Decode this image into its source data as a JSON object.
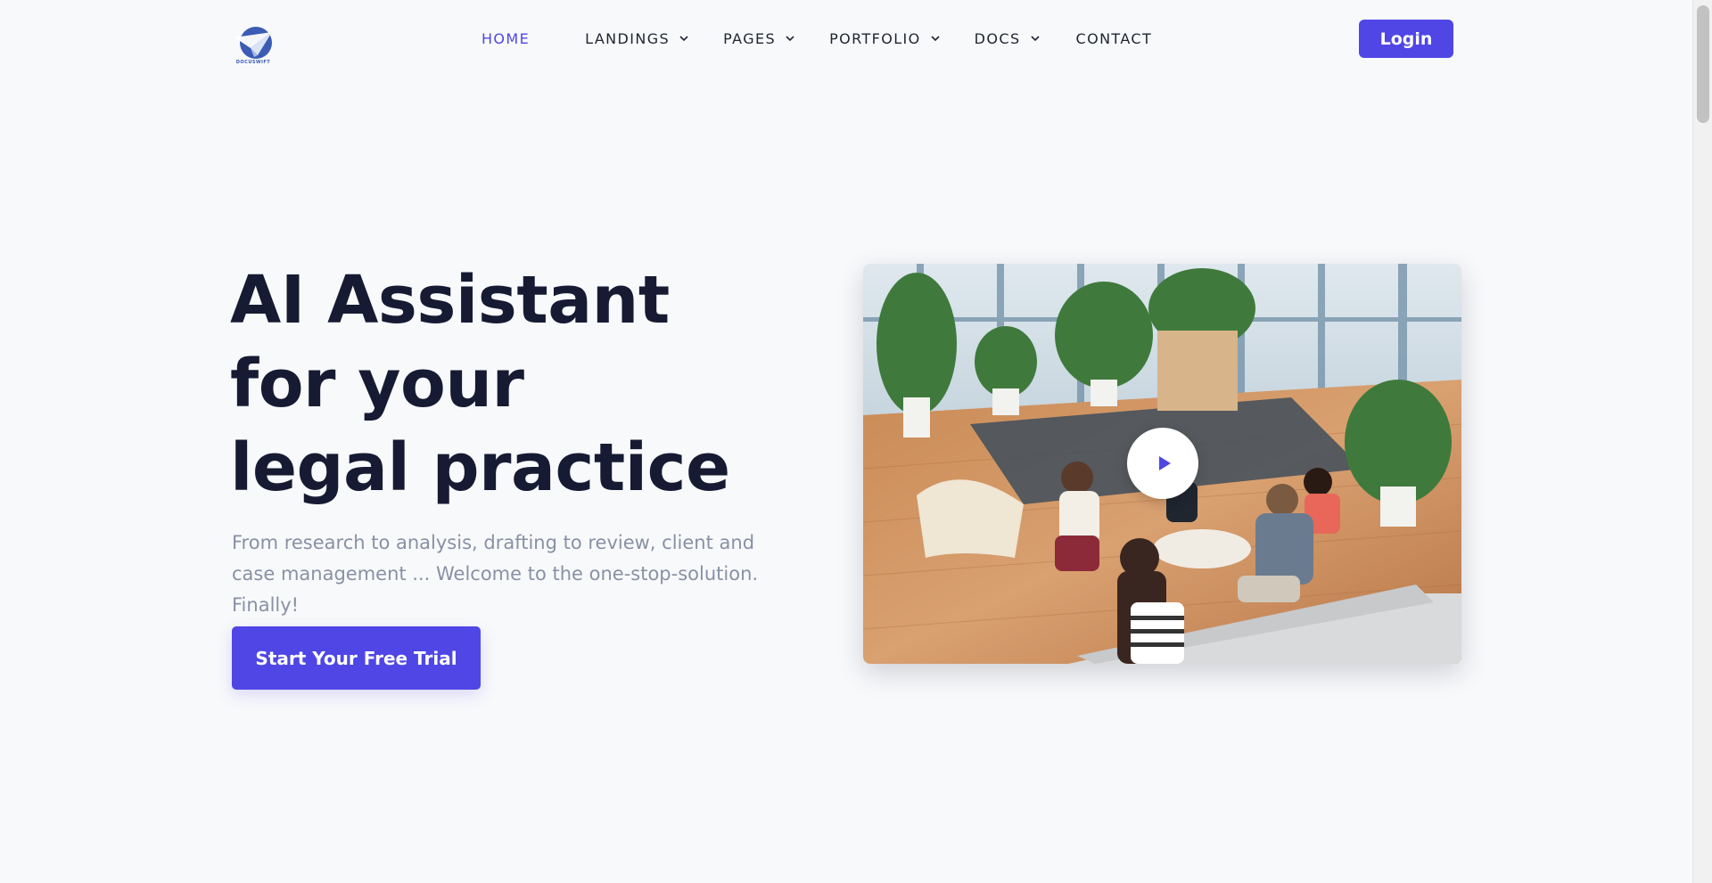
{
  "header": {
    "logo_text": "DOCUSWIFT",
    "nav": [
      {
        "label": "HOME",
        "has_dropdown": false,
        "active": true
      },
      {
        "label": "LANDINGS",
        "has_dropdown": true,
        "active": false
      },
      {
        "label": "PAGES",
        "has_dropdown": true,
        "active": false
      },
      {
        "label": "PORTFOLIO",
        "has_dropdown": true,
        "active": false
      },
      {
        "label": "DOCS",
        "has_dropdown": true,
        "active": false
      },
      {
        "label": "CONTACT",
        "has_dropdown": false,
        "active": false
      }
    ],
    "login_label": "Login"
  },
  "hero": {
    "title_lines": [
      "AI Assistant",
      "for your",
      "legal practice"
    ],
    "subtitle": "From research to analysis, drafting to review, client and case management ... Welcome to the one-stop-solution. Finally!",
    "cta_label": "Start Your Free Trial"
  },
  "media": {
    "play_icon": "play-icon"
  },
  "colors": {
    "accent": "#4f46e5",
    "active_nav": "#5046e4",
    "heading": "#161b33",
    "subtitle": "#8891a4",
    "background": "#f8f9fb"
  }
}
